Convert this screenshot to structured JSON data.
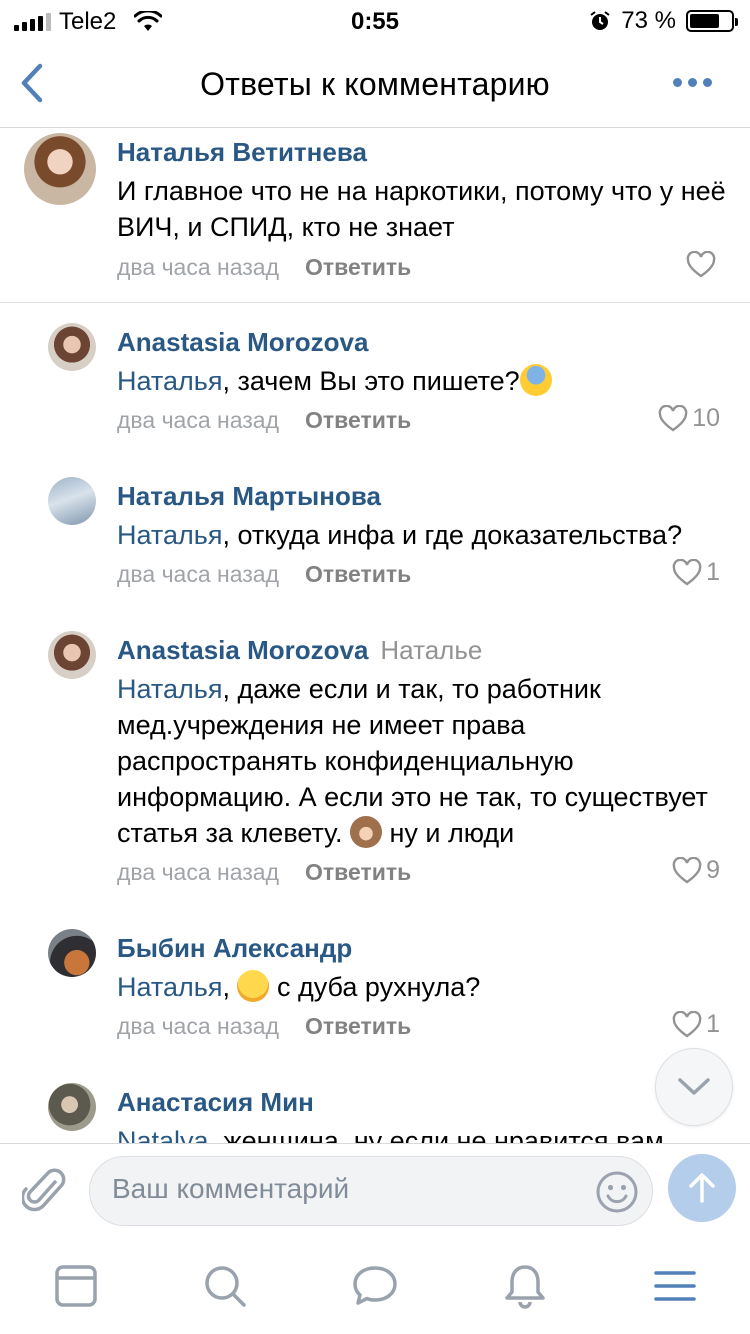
{
  "status": {
    "carrier": "Tele2",
    "time": "0:55",
    "battery_percent": "73 %",
    "battery_level": 0.73
  },
  "header": {
    "title": "Ответы к комментарию",
    "back_icon": "chevron-left-icon",
    "more_icon": "more-dots-icon",
    "accent": "#5181b8"
  },
  "comments": [
    {
      "author": "Наталья Ветитнева",
      "text": "И главное что не на наркотики, потому что у неё ВИЧ, и СПИД, кто не знает",
      "time": "два часа назад",
      "reply": "Ответить",
      "likes": ""
    },
    {
      "author": "Anastasia Morozova",
      "mention": "Наталья",
      "text": ", зачем Вы это пишете?",
      "time": "два часа назад",
      "reply": "Ответить",
      "likes": "10"
    },
    {
      "author": "Наталья Мартынова",
      "mention": "Наталья",
      "text": ", откуда инфа и где доказательства?",
      "time": "два часа назад",
      "reply": "Ответить",
      "likes": "1"
    },
    {
      "author": "Anastasia Morozova",
      "reply_to": "Наталье",
      "mention": "Наталья",
      "text": ", даже если и так, то работник мед.учреждения не имеет права распространять конфиденциальную информацию. А если это не так, то существует статья за клевету. ",
      "text_after": " ну и люди",
      "time": "два часа назад",
      "reply": "Ответить",
      "likes": "9"
    },
    {
      "author": "Быбин Александр",
      "mention": "Наталья",
      "text": ",",
      "text_after": " с дуба рухнула?",
      "time": "два часа назад",
      "reply": "Ответить",
      "likes": "1"
    },
    {
      "author": "Анастасия Мин",
      "mention": "Natalya",
      "text": ", женщина, ну если не нравится вам"
    }
  ],
  "composer": {
    "placeholder": "Ваш комментарий"
  },
  "tabs": [
    "news-tab-icon",
    "search-tab-icon",
    "messages-tab-icon",
    "notifications-tab-icon",
    "menu-tab-icon"
  ]
}
